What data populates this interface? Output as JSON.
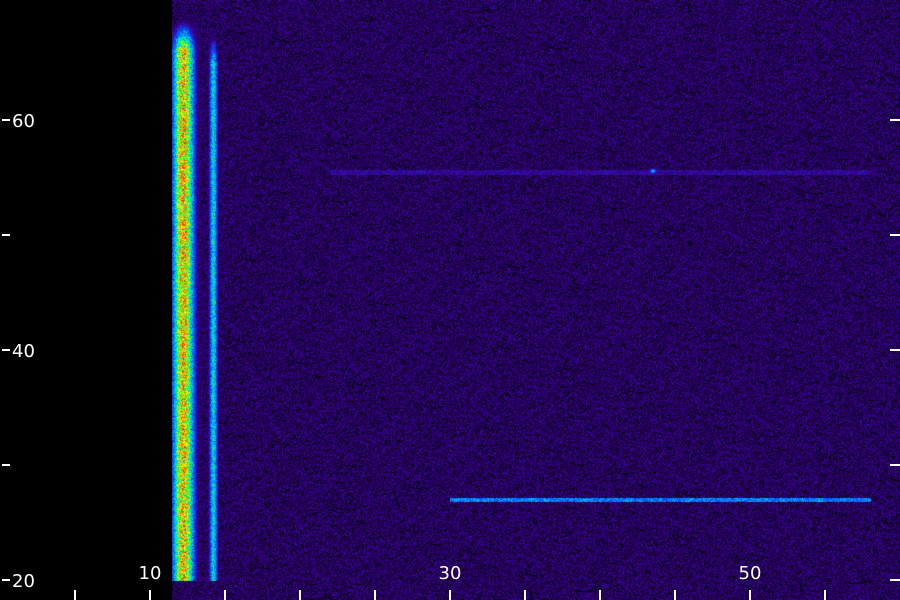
{
  "chart_data": {
    "type": "heatmap",
    "title": "",
    "xlabel": "",
    "ylabel": "",
    "xlim": [
      10,
      58
    ],
    "ylim": [
      20,
      71
    ],
    "x_ticks_major": [
      10,
      30,
      50
    ],
    "x_tick_labels": [
      "10",
      "30",
      "50"
    ],
    "x_ticks_minor": [
      15,
      20,
      25,
      35,
      40,
      45,
      55
    ],
    "y_ticks_major": [
      20,
      40,
      60
    ],
    "y_tick_labels": [
      "20",
      "40",
      "60"
    ],
    "y_ticks_minor": [
      30,
      50
    ],
    "colormap": [
      "#000000",
      "#3a0090",
      "#0050ff",
      "#00c8ff",
      "#00ff50",
      "#ffff00",
      "#ff7800",
      "#ff0000"
    ],
    "background_color": "#000000",
    "noise_color": "#3a0090",
    "features": [
      {
        "kind": "vertical-band",
        "x_center": 12.2,
        "x_width": 0.9,
        "y_from": 20,
        "y_to": 66,
        "peak_intensity": 1.0
      },
      {
        "kind": "vertical-band",
        "x_center": 14.2,
        "x_width": 0.35,
        "y_from": 20,
        "y_to": 65,
        "peak_intensity": 0.6
      },
      {
        "kind": "horizontal-line",
        "y": 27.0,
        "x_from": 30,
        "x_to": 58,
        "intensity": 0.45
      },
      {
        "kind": "horizontal-line",
        "y": 55.5,
        "x_from": 22,
        "x_to": 58,
        "intensity": 0.2
      },
      {
        "kind": "spot",
        "x": 43.5,
        "y": 55.6,
        "intensity": 0.5
      }
    ]
  }
}
